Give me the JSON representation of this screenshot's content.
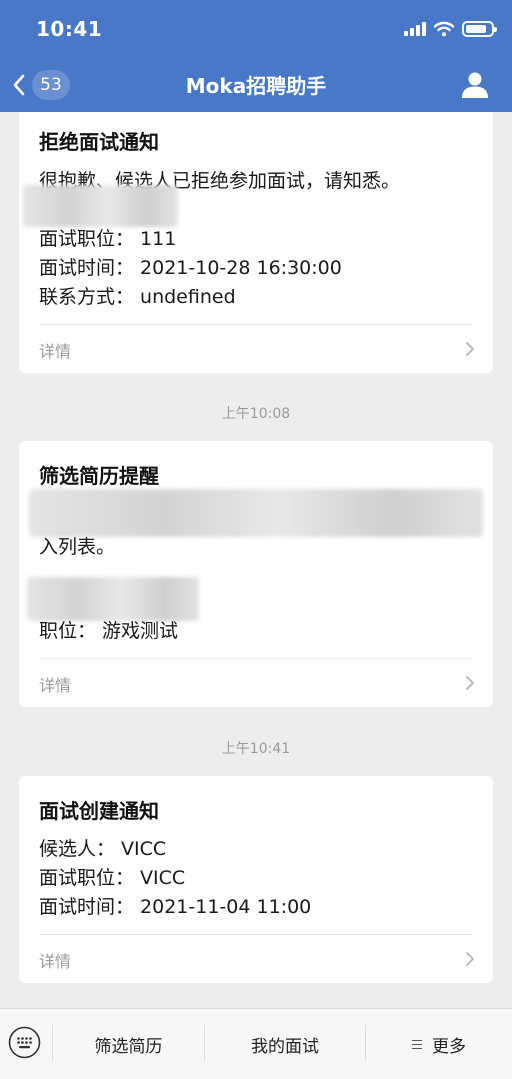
{
  "status_bar": {
    "time": "10:41"
  },
  "nav": {
    "badge_count": "53",
    "title": "Moka招聘助手"
  },
  "cards": [
    {
      "title": "拒绝面试通知",
      "lines": [
        "很抱歉、候选人已拒绝参加面试，请知悉。",
        "面试职位：  111",
        "面试时间：  2021-10-28 16:30:00",
        "联系方式：  undefined"
      ],
      "detail_label": "详情"
    },
    {
      "title": "筛选简历提醒",
      "lines": [
        "入列表。",
        "职位：  游戏测试"
      ],
      "detail_label": "详情"
    },
    {
      "title": "面试创建通知",
      "lines": [
        "候选人：  VICC",
        "面试职位：  VICC",
        "面试时间：  2021-11-04 11:00"
      ],
      "detail_label": "详情"
    }
  ],
  "timestamps": [
    "上午10:08",
    "上午10:41"
  ],
  "bottom_menu": {
    "item1": "筛选简历",
    "item2": "我的面试",
    "item3": "更多"
  },
  "colors": {
    "header": "#4a78c8",
    "background": "#ededed"
  }
}
